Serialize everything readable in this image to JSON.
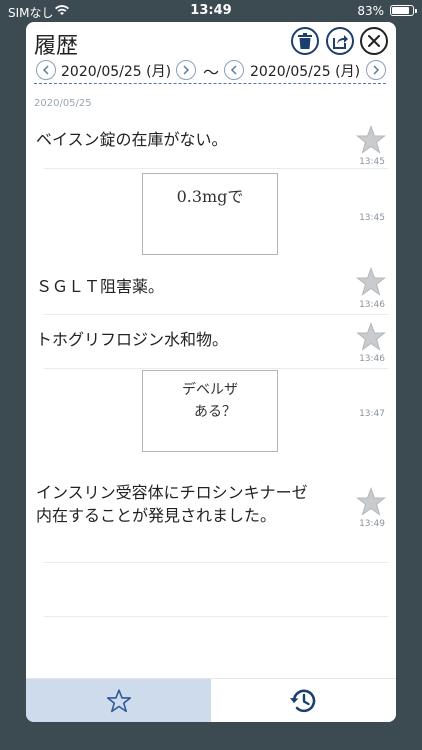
{
  "status_bar": {
    "carrier": "SIMなし",
    "time": "13:49",
    "battery": "83%"
  },
  "header": {
    "title": "履歴",
    "from_date": "2020/05/25 (月)",
    "separator": "〜",
    "to_date": "2020/05/25 (月)"
  },
  "list": {
    "section_date": "2020/05/25",
    "items": [
      {
        "type": "text",
        "text": "ベイスン錠の在庫がない。",
        "time": "13:45",
        "starred": false
      },
      {
        "type": "handwriting",
        "text": "0.3mgで",
        "time": "13:45"
      },
      {
        "type": "text",
        "text": "ＳＧＬＴ阻害薬。",
        "time": "13:46",
        "starred": false
      },
      {
        "type": "text",
        "text": "トホグリフロジン水和物。",
        "time": "13:46",
        "starred": false
      },
      {
        "type": "handwriting",
        "text": "デベルザ ある？",
        "line1": "デベルザ",
        "line2": "ある？",
        "time": "13:47"
      },
      {
        "type": "text",
        "text": "インスリン受容体にチロシンキナーゼ内在することが発見されました。",
        "line1": "インスリン受容体にチロシンキナーゼ",
        "line2": "内在することが発見されました。",
        "time": "13:49",
        "starred": false
      }
    ]
  },
  "tabbar": {
    "tabs": [
      {
        "name": "favorites",
        "icon": "star-outline-icon",
        "selected": true
      },
      {
        "name": "history",
        "icon": "history-icon",
        "selected": false
      }
    ]
  },
  "colors": {
    "background": "#3c4a52",
    "accent": "#1c3f6e",
    "selected_tab": "#cddbec",
    "star": "#c9ccce"
  }
}
